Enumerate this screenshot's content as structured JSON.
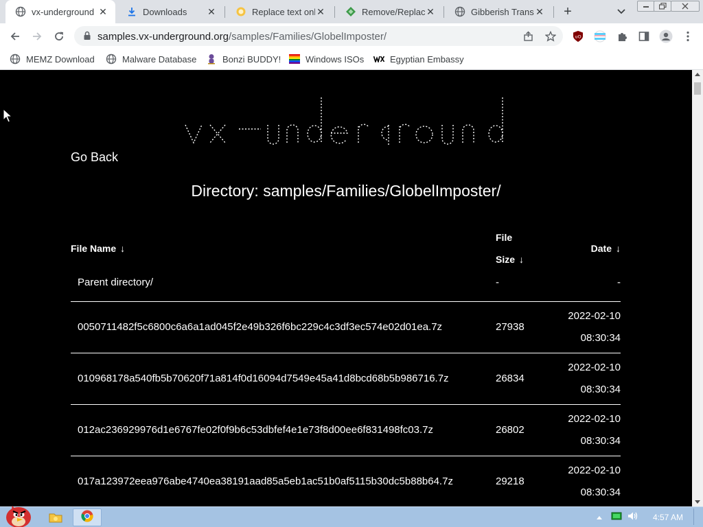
{
  "tabs": [
    {
      "title": "vx-underground",
      "icon": "globe-icon",
      "active": true
    },
    {
      "title": "Downloads",
      "icon": "download-icon",
      "active": false
    },
    {
      "title": "Replace text onl",
      "icon": "replace-icon",
      "active": false
    },
    {
      "title": "Remove/Replace",
      "icon": "diamond-icon",
      "active": false
    },
    {
      "title": "Gibberish Transl",
      "icon": "globe-icon",
      "active": false
    }
  ],
  "address_bar": {
    "host": "samples.vx-underground.org",
    "path": "/samples/Families/GlobelImposter/"
  },
  "bookmarks": [
    {
      "label": "MEMZ Download",
      "icon": "globe-icon"
    },
    {
      "label": "Malware Database",
      "icon": "globe-icon"
    },
    {
      "label": "Bonzi BUDDY!",
      "icon": "bonzi-icon"
    },
    {
      "label": "Windows ISOs",
      "icon": "windows-flag-icon"
    },
    {
      "label": "Egyptian Embassy",
      "icon": "wix-icon"
    }
  ],
  "page": {
    "logo_text": "vx-underground",
    "go_back": "Go Back",
    "directory_title": "Directory: samples/Families/GlobelImposter/",
    "columns": {
      "name": "File Name",
      "size_line1": "File",
      "size_line2": "Size",
      "date": "Date",
      "sort_arrow": "↓"
    },
    "parent": {
      "name": "Parent directory/",
      "size": "-",
      "date": "-"
    },
    "files": [
      {
        "name": "0050711482f5c6800c6a6a1ad045f2e49b326f6bc229c4c3df3ec574e02d01ea.7z",
        "size": "27938",
        "date": "2022-02-10",
        "time": "08:30:34"
      },
      {
        "name": "010968178a540fb5b70620f71a814f0d16094d7549e45a41d8bcd68b5b986716.7z",
        "size": "26834",
        "date": "2022-02-10",
        "time": "08:30:34"
      },
      {
        "name": "012ac236929976d1e6767fe02f0f9b6c53dbfef4e1e73f8d00ee6f831498fc03.7z",
        "size": "26802",
        "date": "2022-02-10",
        "time": "08:30:34"
      },
      {
        "name": "017a123972eea976abe4740ea38191aad85a5eb1ac51b0af5115b30dc5b88b64.7z",
        "size": "29218",
        "date": "2022-02-10",
        "time": "08:30:34"
      }
    ]
  },
  "taskbar": {
    "clock": "4:57 AM"
  },
  "colors": {
    "page_bg": "#000000",
    "chrome_frame": "#dee1e6",
    "taskbar": "#a5c3e3"
  }
}
